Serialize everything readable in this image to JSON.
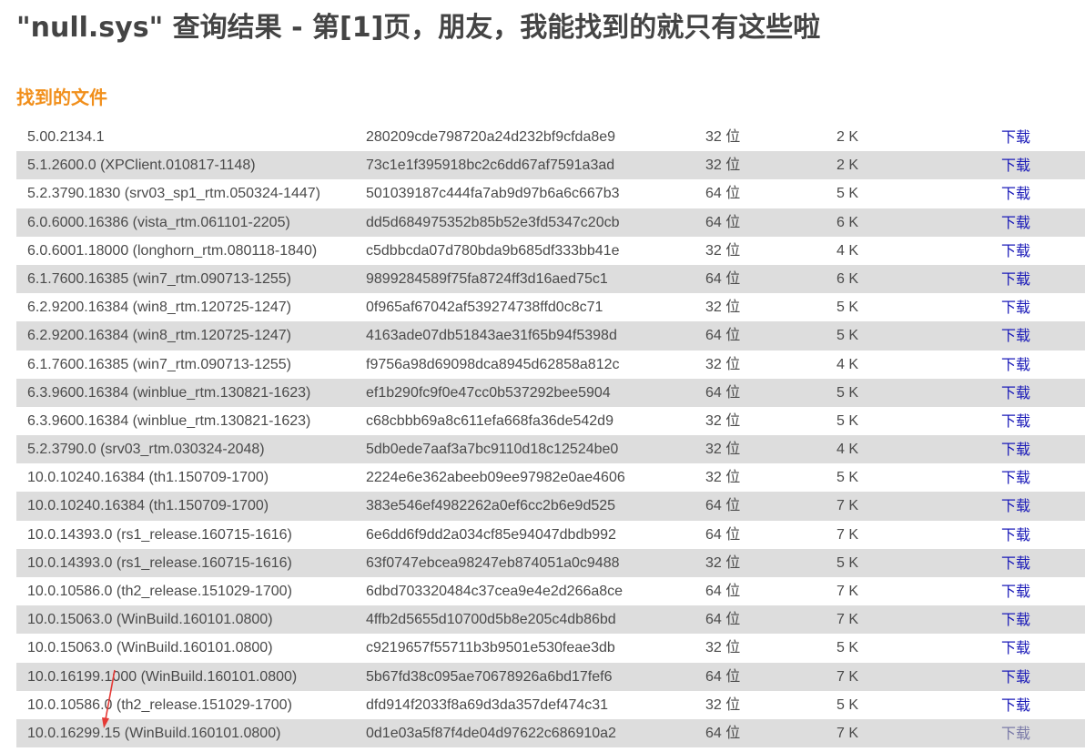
{
  "page": {
    "title": "\"null.sys\" 查询结果 - 第[1]页，朋友，我能找到的就只有这些啦",
    "section_title": "找到的文件"
  },
  "colors": {
    "title": "#444444",
    "section_title": "#f18f1b",
    "row_alt_bg": "#dddddd",
    "download_link": "#1a1ab8",
    "annotation_arrow": "#e53935"
  },
  "files": [
    {
      "version": "5.00.2134.1",
      "hash": "280209cde798720a24d232bf9cfda8e9",
      "arch": "32 位",
      "size": "2 K",
      "download": "下载"
    },
    {
      "version": "5.1.2600.0 (XPClient.010817-1148)",
      "hash": "73c1e1f395918bc2c6dd67af7591a3ad",
      "arch": "32 位",
      "size": "2 K",
      "download": "下载"
    },
    {
      "version": "5.2.3790.1830 (srv03_sp1_rtm.050324-1447)",
      "hash": "501039187c444fa7ab9d97b6a6c667b3",
      "arch": "64 位",
      "size": "5 K",
      "download": "下载"
    },
    {
      "version": "6.0.6000.16386 (vista_rtm.061101-2205)",
      "hash": "dd5d684975352b85b52e3fd5347c20cb",
      "arch": "64 位",
      "size": "6 K",
      "download": "下载"
    },
    {
      "version": "6.0.6001.18000 (longhorn_rtm.080118-1840)",
      "hash": "c5dbbcda07d780bda9b685df333bb41e",
      "arch": "32 位",
      "size": "4 K",
      "download": "下载"
    },
    {
      "version": "6.1.7600.16385 (win7_rtm.090713-1255)",
      "hash": "9899284589f75fa8724ff3d16aed75c1",
      "arch": "64 位",
      "size": "6 K",
      "download": "下载"
    },
    {
      "version": "6.2.9200.16384 (win8_rtm.120725-1247)",
      "hash": "0f965af67042af539274738ffd0c8c71",
      "arch": "32 位",
      "size": "5 K",
      "download": "下载"
    },
    {
      "version": "6.2.9200.16384 (win8_rtm.120725-1247)",
      "hash": "4163ade07db51843ae31f65b94f5398d",
      "arch": "64 位",
      "size": "5 K",
      "download": "下载"
    },
    {
      "version": "6.1.7600.16385 (win7_rtm.090713-1255)",
      "hash": "f9756a98d69098dca8945d62858a812c",
      "arch": "32 位",
      "size": "4 K",
      "download": "下载"
    },
    {
      "version": "6.3.9600.16384 (winblue_rtm.130821-1623)",
      "hash": "ef1b290fc9f0e47cc0b537292bee5904",
      "arch": "64 位",
      "size": "5 K",
      "download": "下载"
    },
    {
      "version": "6.3.9600.16384 (winblue_rtm.130821-1623)",
      "hash": "c68cbbb69a8c611efa668fa36de542d9",
      "arch": "32 位",
      "size": "5 K",
      "download": "下载"
    },
    {
      "version": "5.2.3790.0 (srv03_rtm.030324-2048)",
      "hash": "5db0ede7aaf3a7bc9110d18c12524be0",
      "arch": "32 位",
      "size": "4 K",
      "download": "下载"
    },
    {
      "version": "10.0.10240.16384 (th1.150709-1700)",
      "hash": "2224e6e362abeeb09ee97982e0ae4606",
      "arch": "32 位",
      "size": "5 K",
      "download": "下载"
    },
    {
      "version": "10.0.10240.16384 (th1.150709-1700)",
      "hash": "383e546ef4982262a0ef6cc2b6e9d525",
      "arch": "64 位",
      "size": "7 K",
      "download": "下载"
    },
    {
      "version": "10.0.14393.0 (rs1_release.160715-1616)",
      "hash": "6e6dd6f9dd2a034cf85e94047dbdb992",
      "arch": "64 位",
      "size": "7 K",
      "download": "下载"
    },
    {
      "version": "10.0.14393.0 (rs1_release.160715-1616)",
      "hash": "63f0747ebcea98247eb874051a0c9488",
      "arch": "32 位",
      "size": "5 K",
      "download": "下载"
    },
    {
      "version": "10.0.10586.0 (th2_release.151029-1700)",
      "hash": "6dbd703320484c37cea9e4e2d266a8ce",
      "arch": "64 位",
      "size": "7 K",
      "download": "下载"
    },
    {
      "version": "10.0.15063.0 (WinBuild.160101.0800)",
      "hash": "4ffb2d5655d10700d5b8e205c4db86bd",
      "arch": "64 位",
      "size": "7 K",
      "download": "下载"
    },
    {
      "version": "10.0.15063.0 (WinBuild.160101.0800)",
      "hash": "c9219657f55711b3b9501e530feae3db",
      "arch": "32 位",
      "size": "5 K",
      "download": "下载"
    },
    {
      "version": "10.0.16199.1000 (WinBuild.160101.0800)",
      "hash": "5b67fd38c095ae70678926a6bd17fef6",
      "arch": "64 位",
      "size": "7 K",
      "download": "下载"
    },
    {
      "version": "10.0.10586.0 (th2_release.151029-1700)",
      "hash": "dfd914f2033f8a69d3da357def474c31",
      "arch": "32 位",
      "size": "5 K",
      "download": "下载"
    },
    {
      "version": "10.0.16299.15 (WinBuild.160101.0800)",
      "hash": "0d1e03a5f87f4de04d97622c686910a2",
      "arch": "64 位",
      "size": "7 K",
      "download": "下载"
    }
  ]
}
